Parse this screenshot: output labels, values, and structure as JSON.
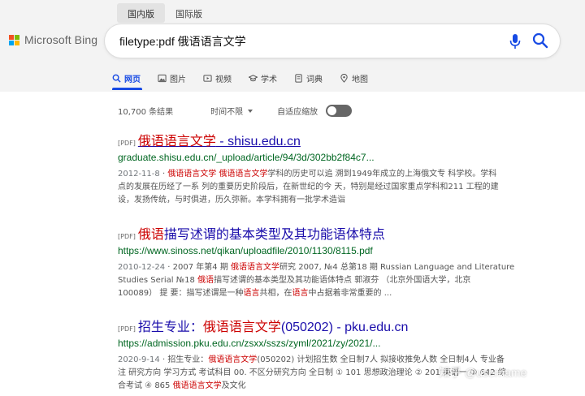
{
  "market_tabs": [
    "国内版",
    "国际版"
  ],
  "brand": {
    "name": "Microsoft Bing",
    "colors": [
      "#f25022",
      "#7fba00",
      "#00a4ef",
      "#ffb900"
    ]
  },
  "search": {
    "query": "filetype:pdf 俄语语言文学"
  },
  "nav": [
    {
      "label": "网页",
      "icon": "search-icon",
      "active": true
    },
    {
      "label": "图片",
      "icon": "image-icon"
    },
    {
      "label": "视频",
      "icon": "video-icon"
    },
    {
      "label": "学术",
      "icon": "academic-cap-icon"
    },
    {
      "label": "词典",
      "icon": "dictionary-icon"
    },
    {
      "label": "地图",
      "icon": "map-pin-icon"
    }
  ],
  "filters": {
    "count": "10,700 条结果",
    "time": "时间不限",
    "adaptive": "自适应缩放"
  },
  "results": [
    {
      "tag": "[PDF]",
      "title_hl": "俄语语言文学",
      "title_rest": " - shisu.edu.cn",
      "url": "graduate.shisu.edu.cn/_upload/article/94/3d/302bb2f84c7...",
      "date": "2012-11-8",
      "snippet": [
        {
          "t": "",
          "h": "俄语语言文学 俄语语言文学",
          "r": "学科的历史可以追 溯到1949年成立的上海俄文专 科学校。学科"
        },
        {
          "t": "点的发展在历经了一系 列的重要历史阶段后，在新世纪的今 天，特别是经过国家重点学科和211 工程的建"
        },
        {
          "t": "设，发扬传统，与时俱进，历久弥新。本学科拥有一批学术造诣"
        }
      ]
    },
    {
      "tag": "[PDF]",
      "title_hl": "俄语",
      "title_rest": "描写述谓的基本类型及其功能语体特点",
      "url": "https://www.sinoss.net/qikan/uploadfile/2010/1130/8115.pdf",
      "date": "2010-12-24",
      "line1_a": "2007 年第4 期 ",
      "line1_h": "俄语语言文学",
      "line1_b": "研究 2007, №4 总第18 期 Russian Language and Literature",
      "line2_a": "Studies Serial №18 ",
      "line2_h": "俄语",
      "line2_b": "描写述谓的基本类型及其功能语体特点 郭淑芬 （北京外国语大学，北京",
      "line3_a": "100089） 提 要：描写述谓是一种",
      "line3_h": "语言",
      "line3_b": "共相，在",
      "line3_h2": "语言",
      "line3_c": "中占据着非常重要的 ..."
    },
    {
      "tag": "[PDF]",
      "title_a": "招生专业：",
      "title_hl": "俄语语言文学",
      "title_rest": "(050202) - pku.edu.cn",
      "url": "https://admission.pku.edu.cn/zsxx/sszs/zyml/2021/zy/2021/...",
      "date": "2020-9-14",
      "line1_a": "招生专业：",
      "line1_h": "俄语语言文学",
      "line1_b": "(050202) 计划招生数 全日制7人 拟接收推免人数 全日制4人 专业备",
      "line2": "注 研究方向 学习方式 考试科目 00. 不区分研究方向 全日制 ① 101 思想政治理论 ② 201 英语一 ③ 642 综",
      "line3_a": "合考试 ④ 865 ",
      "line3_h": "俄语语言文学",
      "line3_b": "及文化"
    }
  ],
  "watermark": "知乎 @username"
}
